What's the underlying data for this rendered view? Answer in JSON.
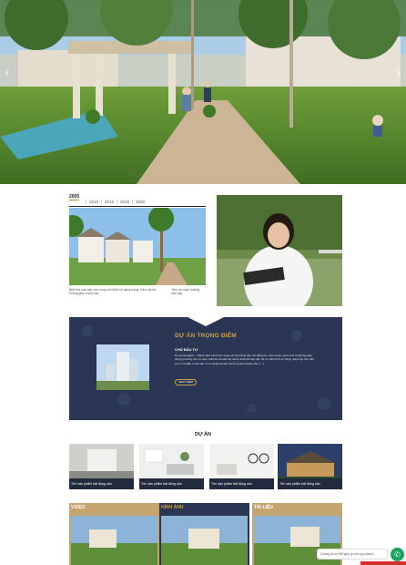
{
  "hero": {
    "prev_glyph": "‹",
    "next_glyph": "›"
  },
  "timeline": {
    "first_tab": "2005",
    "tabs": [
      "2010",
      "2015",
      "2015",
      "2020"
    ],
    "caption_left": "Biệt thự cao cấp ven sông với thiết kế sang trọng, hiện đại và không gian xanh mát",
    "caption_right": "Tiện ích nghỉ dưỡng cao cấp"
  },
  "featured": {
    "title": "DỰ ÁN TRỌNG ĐIỂM",
    "subtitle": "CHỦ ĐẦU TƯ",
    "description": "Dự án Ecopark – Thành phố xanh bên sông với hệ thống tiện ích đồng bộ, cảnh quan xanh mát và không gian sống lý tưởng cho cư dân. Căn hộ và biệt thự được thiết kế hiện đại, tối ưu diện tích sử dụng, đáp ứng nhu cầu an cư và đầu tư lâu dài. Vị trí thuận lợi kết nối trung tâm thành phố. […]",
    "button_label": "XEM THÊM"
  },
  "duan": {
    "title": "DỰ ÁN",
    "cards": [
      {
        "label": "Tên sản phẩm bất động sản"
      },
      {
        "label": "Tên sản phẩm bất động sản"
      },
      {
        "label": "Tên sản phẩm bất động sản"
      },
      {
        "label": "Tên sản phẩm bất động sản"
      }
    ]
  },
  "media": [
    {
      "title": "VIDEO"
    },
    {
      "title": "HÌNH ẢNH"
    },
    {
      "title": "TÀI LIỆU"
    }
  ],
  "chat": {
    "bubble_text": "Chúng tôi có thể giúp gì cho quý khách",
    "icon": "chat-icon",
    "icon_glyph": "✆"
  },
  "colors": {
    "navy": "#2a3653",
    "gold": "#c9a24a",
    "green": "#1aa260",
    "red": "#d32f2f"
  }
}
